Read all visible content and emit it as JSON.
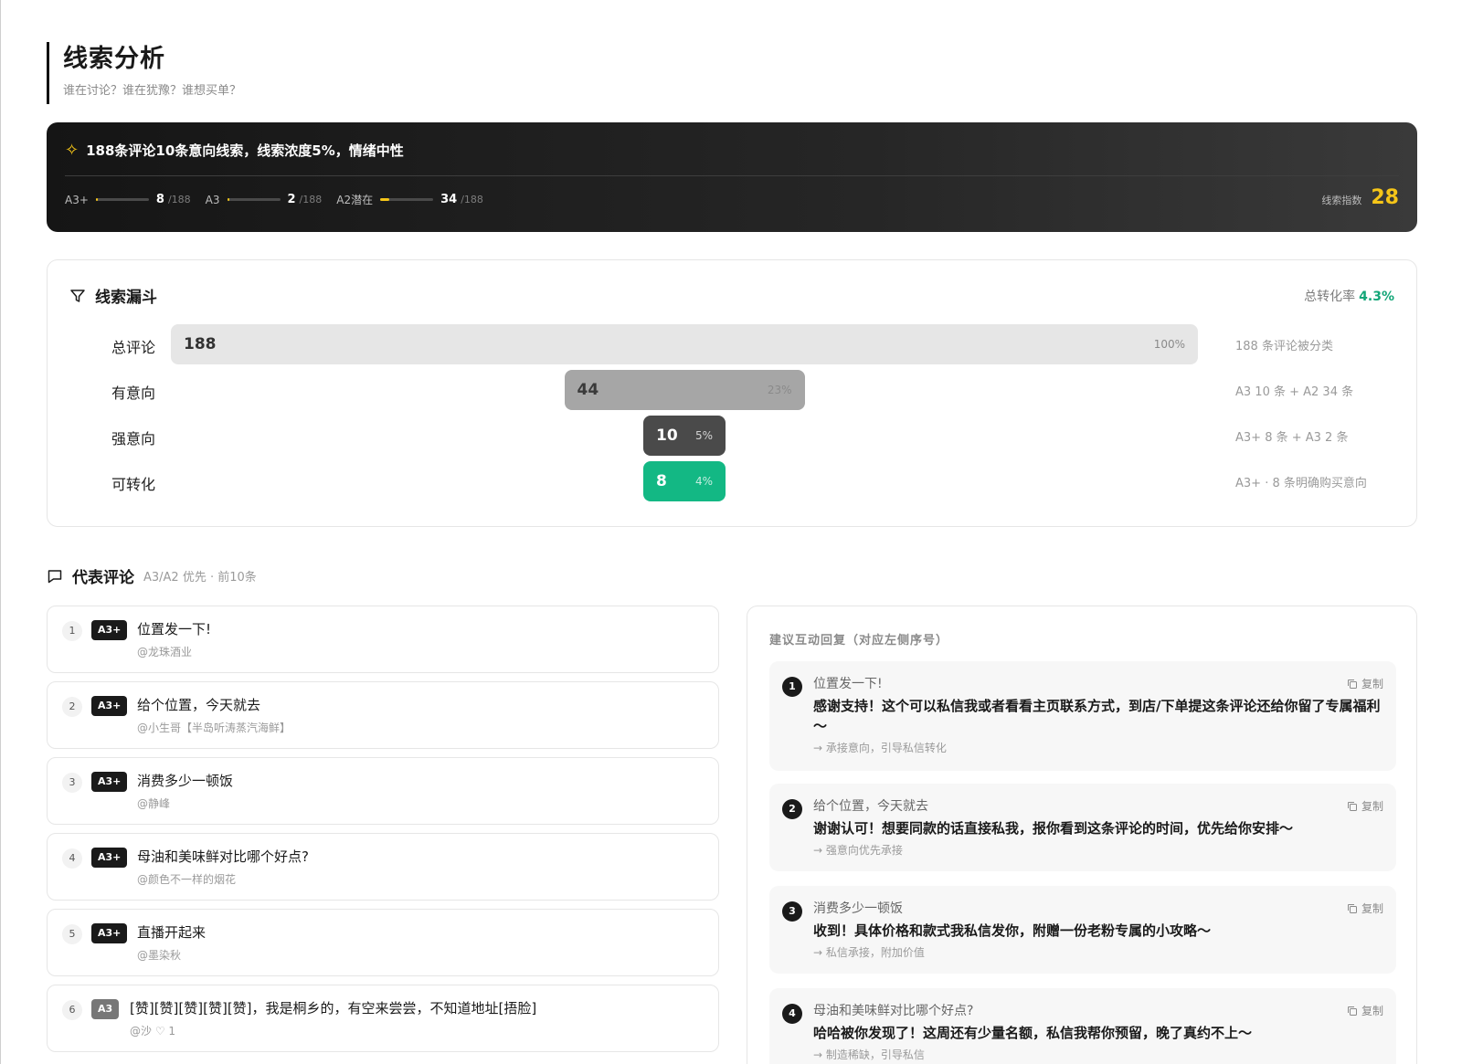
{
  "header": {
    "title": "线索分析",
    "subtitle": "谁在讨论？谁在犹豫？谁想买单？"
  },
  "banner": {
    "summary": "188条评论10条意向线索，线索浓度5%，情绪中性",
    "metrics": [
      {
        "label": "A3+",
        "value": "8",
        "total": "/188",
        "fraction": 0.043
      },
      {
        "label": "A3",
        "value": "2",
        "total": "/188",
        "fraction": 0.011
      },
      {
        "label": "A2潜在",
        "value": "34",
        "total": "/188",
        "fraction": 0.18
      }
    ],
    "index_label": "线索指数",
    "index_value": "28",
    "accent_color": "#f5c518"
  },
  "funnel": {
    "title": "线索漏斗",
    "rate_label": "总转化率",
    "rate_value": "4.3%",
    "rows": [
      {
        "label": "总评论",
        "value": "188",
        "percent": "100%",
        "share": 1.0,
        "note": "188 条评论被分类",
        "color": "#e6e6e6"
      },
      {
        "label": "有意向",
        "value": "44",
        "percent": "23%",
        "share": 0.234,
        "note": "A3 10 条 + A2 34 条",
        "color": "#a6a6a6"
      },
      {
        "label": "强意向",
        "value": "10",
        "percent": "5%",
        "share": 0.053,
        "note": "A3+ 8 条 + A3 2 条",
        "color": "#4a4a4a"
      },
      {
        "label": "可转化",
        "value": "8",
        "percent": "4%",
        "share": 0.043,
        "note": "A3+ · 8 条明确购买意向",
        "color": "#13b884"
      }
    ]
  },
  "comments": {
    "title": "代表评论",
    "subtitle": "A3/A2 优先 · 前10条",
    "items": [
      {
        "index": "1",
        "badge": "A3+",
        "text": "位置发一下!",
        "user": "@龙珠酒业"
      },
      {
        "index": "2",
        "badge": "A3+",
        "text": "给个位置，今天就去",
        "user": "@小生哥【半岛听涛蒸汽海鲜】"
      },
      {
        "index": "3",
        "badge": "A3+",
        "text": "消费多少一顿饭",
        "user": "@静峰"
      },
      {
        "index": "4",
        "badge": "A3+",
        "text": "母油和美味鲜对比哪个好点?",
        "user": "@颜色不一样的烟花"
      },
      {
        "index": "5",
        "badge": "A3+",
        "text": "直播开起来",
        "user": "@墨染秋"
      },
      {
        "index": "6",
        "badge": "A3",
        "text": "[赞][赞][赞][赞][赞]，我是桐乡的，有空来尝尝，不知道地址[捂脸]",
        "user": "@沙  ♡ 1"
      }
    ]
  },
  "replies": {
    "title": "建议互动回复（对应左侧序号）",
    "copy_label": "复制",
    "items": [
      {
        "index": "1",
        "quote": "位置发一下!",
        "answer": "感谢支持！这个可以私信我或者看看主页联系方式，到店/下单提这条评论还给你留了专属福利～",
        "tip": "→ 承接意向，引导私信转化"
      },
      {
        "index": "2",
        "quote": "给个位置，今天就去",
        "answer": "谢谢认可！想要同款的话直接私我，报你看到这条评论的时间，优先给你安排～",
        "tip": "→ 强意向优先承接"
      },
      {
        "index": "3",
        "quote": "消费多少一顿饭",
        "answer": "收到！具体价格和款式我私信发你，附赠一份老粉专属的小攻略～",
        "tip": "→ 私信承接，附加价值"
      },
      {
        "index": "4",
        "quote": "母油和美味鲜对比哪个好点?",
        "answer": "哈哈被你发现了！这周还有少量名额，私信我帮你预留，晚了真约不上～",
        "tip": "→ 制造稀缺，引导私信"
      }
    ]
  }
}
